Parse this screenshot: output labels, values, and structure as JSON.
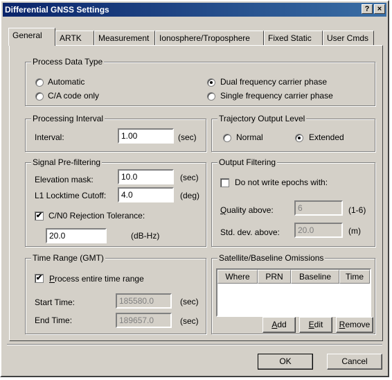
{
  "window": {
    "title": "Differential GNSS Settings",
    "help_label": "?",
    "close_label": "×"
  },
  "tabs": [
    "General",
    "ARTK",
    "Measurement",
    "Ionosphere/Troposphere",
    "Fixed Static",
    "User Cmds"
  ],
  "process_data_type": {
    "legend": "Process Data Type",
    "options": [
      "Automatic",
      "C/A code only",
      "Dual frequency carrier phase",
      "Single frequency carrier phase"
    ],
    "selected": "Dual frequency carrier phase"
  },
  "processing_interval": {
    "legend": "Processing Interval",
    "label": "Interval:",
    "value": "1.00",
    "unit": "(sec)"
  },
  "trajectory_output": {
    "legend": "Trajectory Output Level",
    "options": [
      "Normal",
      "Extended"
    ],
    "selected": "Extended"
  },
  "signal_prefiltering": {
    "legend": "Signal Pre-filtering",
    "elevation_label": "Elevation mask:",
    "elevation_value": "10.0",
    "elevation_unit": "(sec)",
    "locktime_label": "L1 Locktime Cutoff:",
    "locktime_value": "4.0",
    "locktime_unit": "(deg)",
    "cn0_label": "C/N0 Rejection Tolerance:",
    "cn0_checked": true,
    "cn0_value": "20.0",
    "cn0_unit": "(dB-Hz)"
  },
  "output_filtering": {
    "legend": "Output Filtering",
    "checkbox_label": "Do not write epochs with:",
    "checked": false,
    "quality_label_u": "Q",
    "quality_label_rest": "uality above:",
    "quality_value": "6",
    "quality_range": "(1-6)",
    "stddev_label": "Std. dev. above:",
    "stddev_value": "20.0",
    "stddev_unit": "(m)"
  },
  "time_range": {
    "legend": "Time Range (GMT)",
    "checkbox_u": "P",
    "checkbox_rest": "rocess entire time range",
    "checked": true,
    "start_label": "Start Time:",
    "start_value": "185580.0",
    "start_unit": "(sec)",
    "end_label": "End Time:",
    "end_value": "189657.0",
    "end_unit": "(sec)"
  },
  "omissions": {
    "legend": "Satellite/Baseline Omissions",
    "columns": [
      "Where",
      "PRN",
      "Baseline",
      "Time"
    ],
    "add_u": "A",
    "add_rest": "dd",
    "edit_u": "E",
    "edit_rest": "dit",
    "remove_u": "R",
    "remove_rest": "emove"
  },
  "footer": {
    "ok": "OK",
    "cancel": "Cancel"
  }
}
